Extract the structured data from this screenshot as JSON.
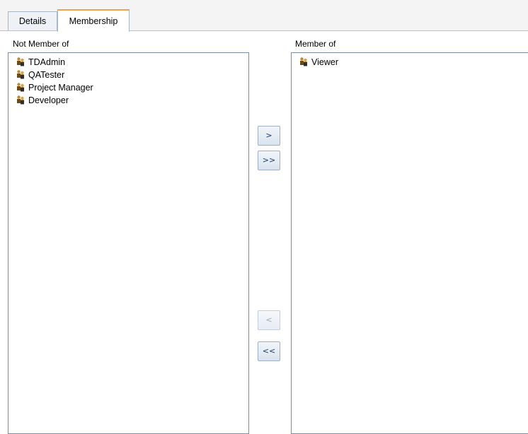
{
  "tabs": [
    {
      "label": "Details"
    },
    {
      "label": "Membership",
      "active": true
    }
  ],
  "not_member": {
    "caption": "Not Member of",
    "items": [
      "TDAdmin",
      "QATester",
      "Project Manager",
      "Developer"
    ]
  },
  "member": {
    "caption": "Member of",
    "items": [
      "Viewer"
    ]
  },
  "buttons": {
    "add": ">",
    "add_all": ">>",
    "remove": "<",
    "remove_all": "<<"
  },
  "icons": {
    "group": "group-icon"
  },
  "colors": {
    "active_tab_accent": "#f2a24c",
    "list_border": "#7c8ea7"
  }
}
